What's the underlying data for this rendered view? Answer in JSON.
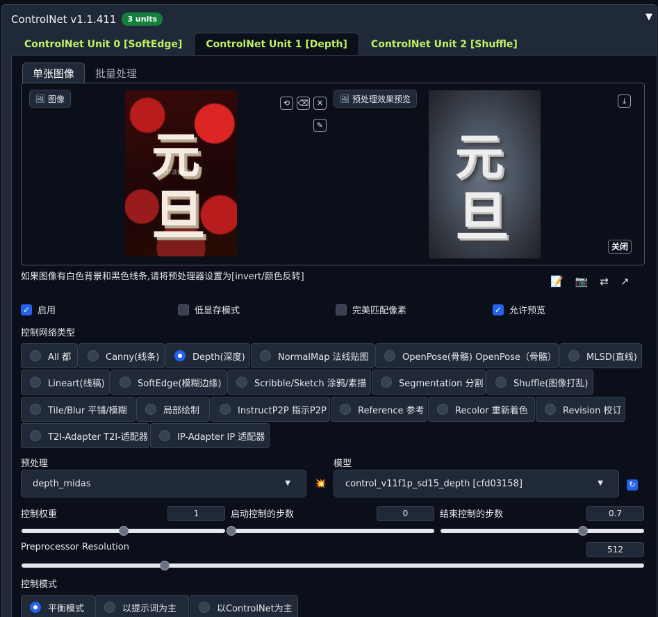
{
  "header": {
    "title": "ControlNet v1.1.411",
    "badge": "3 units",
    "collapse_glyph": "▼"
  },
  "unit_tabs": [
    {
      "label": "ControlNet Unit 0 [SoftEdge]",
      "active": false
    },
    {
      "label": "ControlNet Unit 1 [Depth]",
      "active": true
    },
    {
      "label": "ControlNet Unit 2 [Shuffle]",
      "active": false
    }
  ],
  "image_tabs": [
    {
      "label": "单张图像",
      "active": true
    },
    {
      "label": "批量处理",
      "active": false
    }
  ],
  "image_panel": {
    "input_label": "图像",
    "preview_label": "预处理效果预览",
    "source_glyph_top": "元",
    "source_glyph_bottom": "旦",
    "source_watermark": "drawing",
    "close_label": "关闭"
  },
  "hint_text": "如果图像有白色背景和黑色线条,请将预处理器设置为[invert/颜色反转]",
  "checkboxes": [
    {
      "label": "启用",
      "checked": true
    },
    {
      "label": "低显存模式",
      "checked": false
    },
    {
      "label": "完美匹配像素",
      "checked": false
    },
    {
      "label": "允许预览",
      "checked": true
    }
  ],
  "control_type": {
    "label": "控制网络类型",
    "options": [
      {
        "label": "All 都",
        "selected": false
      },
      {
        "label": "Canny(线条)",
        "selected": false
      },
      {
        "label": "Depth(深度)",
        "selected": true
      },
      {
        "label": "NormalMap 法线贴图",
        "selected": false
      },
      {
        "label": "OpenPose(骨骼) OpenPose（骨骼）",
        "selected": false
      },
      {
        "label": "MLSD(直线)",
        "selected": false
      },
      {
        "label": "Lineart(线稿)",
        "selected": false
      },
      {
        "label": "SoftEdge(模糊边缘)",
        "selected": false
      },
      {
        "label": "Scribble/Sketch 涂鸦/素描",
        "selected": false
      },
      {
        "label": "Segmentation 分割",
        "selected": false
      },
      {
        "label": "Shuffle(图像打乱)",
        "selected": false
      },
      {
        "label": "Tile/Blur 平铺/模糊",
        "selected": false
      },
      {
        "label": "局部绘制",
        "selected": false
      },
      {
        "label": "InstructP2P 指示P2P",
        "selected": false
      },
      {
        "label": "Reference 参考",
        "selected": false
      },
      {
        "label": "Recolor 重新着色",
        "selected": false
      },
      {
        "label": "Revision 校订",
        "selected": false
      },
      {
        "label": "T2I-Adapter T2I-适配器",
        "selected": false
      },
      {
        "label": "IP-Adapter IP 适配器",
        "selected": false
      }
    ]
  },
  "preprocessor": {
    "label": "预处理",
    "value": "depth_midas"
  },
  "model": {
    "label": "模型",
    "value": "control_v11f1p_sd15_depth [cfd03158]"
  },
  "sliders": {
    "weight": {
      "label": "控制权重",
      "value": "1",
      "fraction": 0.5
    },
    "start": {
      "label": "启动控制的步数",
      "value": "0",
      "fraction": 0.0
    },
    "end": {
      "label": "结束控制的步数",
      "value": "0.7",
      "fraction": 0.7
    },
    "resolution": {
      "label": "Preprocessor Resolution",
      "value": "512",
      "fraction": 0.23
    }
  },
  "control_mode": {
    "label": "控制模式",
    "options": [
      {
        "label": "平衡模式",
        "selected": true
      },
      {
        "label": "以提示词为主",
        "selected": false
      },
      {
        "label": "以ControlNet为主",
        "selected": false
      }
    ]
  }
}
